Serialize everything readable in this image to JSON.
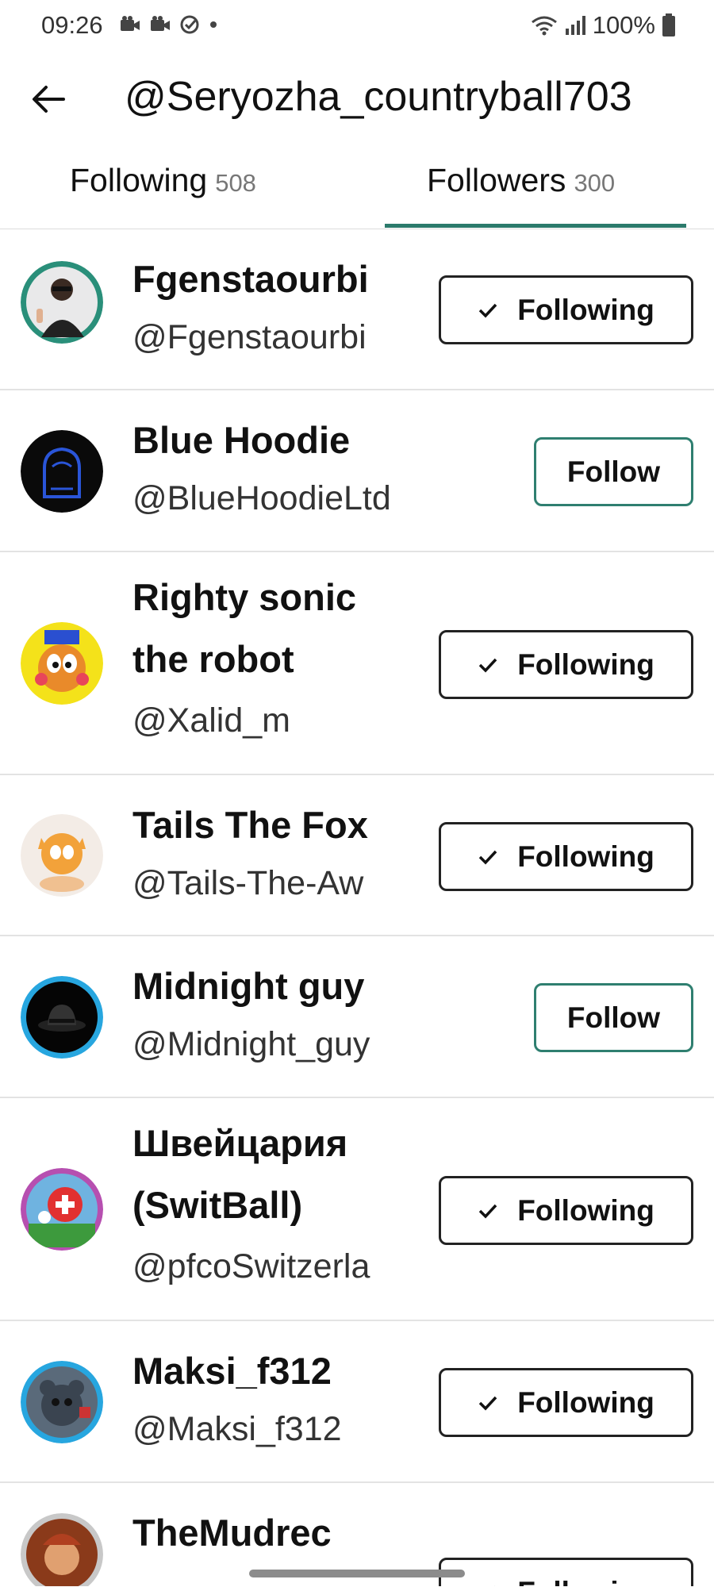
{
  "status_bar": {
    "time": "09:26",
    "battery": "100%",
    "icons": [
      "video-camera-icon",
      "video-camera-icon",
      "check-circle-icon",
      "dot-icon",
      "wifi-icon",
      "signal-icon",
      "battery-icon"
    ]
  },
  "header": {
    "back_icon": "arrow-left-icon",
    "profile_handle": "@Seryozha_countryball703"
  },
  "tabs": [
    {
      "label": "Following",
      "count": "508",
      "active": false
    },
    {
      "label": "Followers",
      "count": "300",
      "active": true
    }
  ],
  "colors": {
    "accent": "#2b7a6b",
    "text": "#111111",
    "divider": "#e3e3e3"
  },
  "users": [
    {
      "name": "Fgenstaourbi",
      "handle": "@Fgenstaourbi",
      "button": "Following"
    },
    {
      "name": "Blue Hoodie",
      "handle": "@BlueHoodieLtd",
      "button": "Follow"
    },
    {
      "name": "Righty sonic the robot",
      "name_line1": "Righty sonic",
      "name_line2": "the robot",
      "handle": "@Xalid_m",
      "button": "Following"
    },
    {
      "name": "Tails The Fox",
      "handle": "@Tails-The-Aw",
      "button": "Following"
    },
    {
      "name": "Midnight guy",
      "handle": "@Midnight_guy",
      "button": "Follow"
    },
    {
      "name": "Швейцария (SwitBall)",
      "name_line1": "Швейцария",
      "name_line2": "(SwitBall)",
      "handle": "@pfcoSwitzerla",
      "button": "Following"
    },
    {
      "name": "Maksi_f312",
      "handle": "@Maksi_f312",
      "button": "Following"
    },
    {
      "name": "TheMudrec",
      "handle": "",
      "button": "Following"
    }
  ]
}
